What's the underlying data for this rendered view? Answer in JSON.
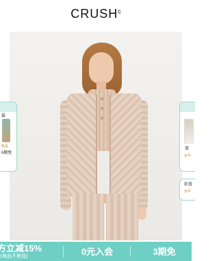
{
  "header": {
    "logo_text": "CRUSH",
    "logo_sup": "c"
  },
  "floating_cards": {
    "left": {
      "line1": "装",
      "line2": "新品",
      "line3": "6期免",
      "accent": "#9fd6cf"
    },
    "right": {
      "line1": "双",
      "line2": "女牛",
      "line3": "彩虫",
      "line4": "女牛"
    }
  },
  "bottom_promo": {
    "left_title": "方立减15%",
    "left_sub": "分商品不参加)",
    "mid_title": "0元入会",
    "right_title": "3期免",
    "bg_color": "#6ecfc5"
  }
}
